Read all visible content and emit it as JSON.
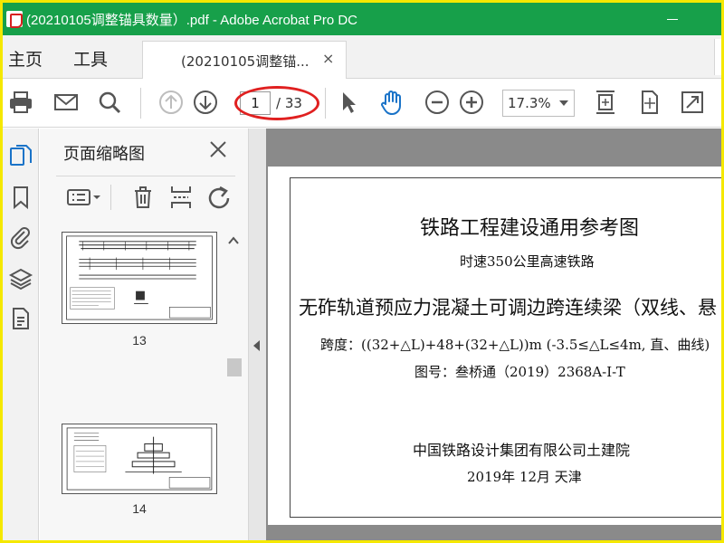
{
  "window": {
    "title": "(20210105调整锚具数量）.pdf - Adobe Acrobat Pro DC",
    "minimize_icon": "minimize-icon",
    "frame_color": "#f5e800",
    "titlebar_color": "#17a04a"
  },
  "menu": {
    "home": "主页",
    "tools": "工具"
  },
  "tab": {
    "label": "(20210105调整锚...",
    "close": "×"
  },
  "toolbar": {
    "icons": [
      "print-icon",
      "email-icon",
      "search-icon",
      "previous-page-icon",
      "next-page-icon",
      "select-arrow-icon",
      "hand-tool-icon",
      "zoom-out-icon",
      "zoom-in-icon",
      "fit-page-icon",
      "full-screen-icon"
    ],
    "page_current": "1",
    "page_total": "/ 33",
    "zoom": "17.3%",
    "highlight_color": "#e02020"
  },
  "left_rail": {
    "icons": [
      "page-thumbnails-icon",
      "bookmarks-icon",
      "attachments-icon",
      "layers-icon",
      "page-document-icon"
    ],
    "active": "page-thumbnails-icon",
    "accent": "#1a73c8"
  },
  "thumbnails_panel": {
    "title": "页面缩略图",
    "tools": [
      "options-menu-icon",
      "delete-icon",
      "insert-pages-icon",
      "rotate-icon"
    ],
    "pages": [
      {
        "number": "13"
      },
      {
        "number": "14"
      }
    ]
  },
  "document": {
    "title": "铁路工程建设通用参考图",
    "subtitle": "时速350公里高速铁路",
    "main_title": "无砟轨道预应力混凝土可调边跨连续梁（双线、悬",
    "span": "跨度：((32+△L)+48+(32+△L))m (-3.5≤△L≤4m, 直、曲线)",
    "drawing_no": "图号：叁桥通（2019）2368A-Ⅰ-T",
    "organization": "中国铁路设计集团有限公司土建院",
    "date": "2019年 12月    天津"
  }
}
